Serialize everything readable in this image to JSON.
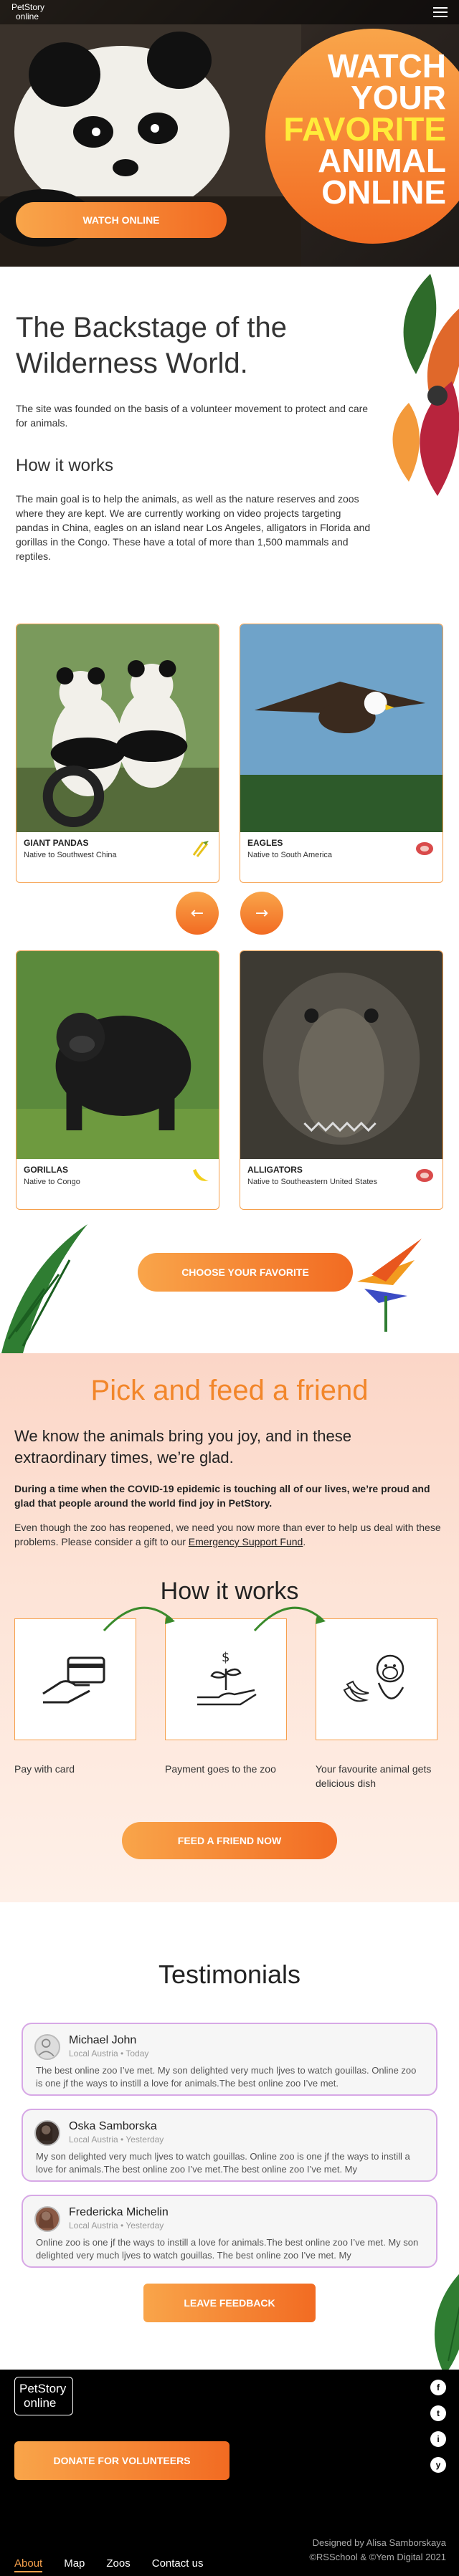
{
  "header": {
    "logo": "PetStory online",
    "logo_line1": "PetStory",
    "logo_line2": "online",
    "hero_title_1": "Watch your",
    "hero_title_2": "favorite",
    "hero_title_3": "animal",
    "hero_title_4": "online",
    "hero_button": "WATCH ONLINE"
  },
  "about": {
    "title": "The Backstage of the Wilderness World.",
    "intro": "The site was founded on the basis of a volunteer movement to protect and care for animals.",
    "how_title": "How it works",
    "how_text": "The main goal is to help the animals, as well as the nature reserves and zoos where they are kept. We are currently working on video projects targeting pandas in China, eagles on an island near Los Angeles, alligators in Florida and gorillas in the Congo. These have a total of more than 1,500 mammals and reptiles."
  },
  "animals": [
    {
      "name": "GIANT PANDAS",
      "native": "Native to Southwest China",
      "food_icon": "bamboo-icon"
    },
    {
      "name": "EAGLES",
      "native": "Native to South America",
      "food_icon": "meat-icon"
    },
    {
      "name": "GORILLAS",
      "native": "Native to Congo",
      "food_icon": "banana-icon"
    },
    {
      "name": "ALLIGATORS",
      "native": "Native to Southeastern United States",
      "food_icon": "meat-icon"
    }
  ],
  "slider": {
    "prev": "←",
    "next": "→"
  },
  "choose_button": "CHOOSE YOUR FAVORITE",
  "feed": {
    "title": "Pick and feed a friend",
    "lead": "We know the animals bring you joy, and in these extraordinary times, we’re glad.",
    "bold": "During a time when the COVID-19 epidemic is touching all of our lives, we’re proud and glad that people around the world find joy in PetStory.",
    "normal": "Even though the zoo has reopened, we need you now more than ever to help us deal with these problems. Please consider a gift to our",
    "link": "Emergency Support Fund",
    "normal_end": ".",
    "how_title": "How it works",
    "steps": [
      {
        "label": "Pay with card",
        "icon": "credit-card-icon"
      },
      {
        "label": "Payment goes to the zoo",
        "icon": "hand-plant-icon"
      },
      {
        "label": "Your favourite animal gets delicious dish",
        "icon": "monkey-banana-icon"
      }
    ],
    "button": "FEED A FRIEND NOW"
  },
  "testimonials": {
    "title": "Testimonials",
    "items": [
      {
        "name": "Michael John",
        "meta": "Local Austria  •  Today",
        "text": "The best online zoo I’ve met. My son delighted very much ljves to watch gouillas. Online zoo is one jf the ways to instill a love for animals.The best online zoo I’ve met."
      },
      {
        "name": "Oska Samborska",
        "meta": "Local Austria  •  Yesterday",
        "text": "My son delighted very much ljves to watch gouillas. Online zoo is one jf the ways to instill a love for animals.The best online zoo I’ve met.The best online zoo I’ve met. My"
      },
      {
        "name": "Fredericka Michelin",
        "meta": "Local Austria  •  Yesterday",
        "text": "Online zoo is one jf the ways to instill a love for animals.The best online zoo I’ve met. My son delighted very much ljves to watch gouillas. The best online zoo I’ve met. My"
      }
    ],
    "button": "LEAVE FEEDBACK"
  },
  "footer": {
    "logo_line1": "PetStory",
    "logo_line2": "online",
    "donate_button": "DONATE FOR VOLUNTEERS",
    "socials": [
      "f",
      "t",
      "i",
      "y"
    ],
    "credit_1": "Designed by Alisa Samborskaya",
    "credit_2": "©RSSchool & ©Yem Digital 2021",
    "nav": [
      "About",
      "Map",
      "Zoos",
      "Contact us"
    ]
  },
  "colors": {
    "accent": "#f6a04c",
    "accent_dark": "#f26b22",
    "feed_title": "#f2862a"
  }
}
